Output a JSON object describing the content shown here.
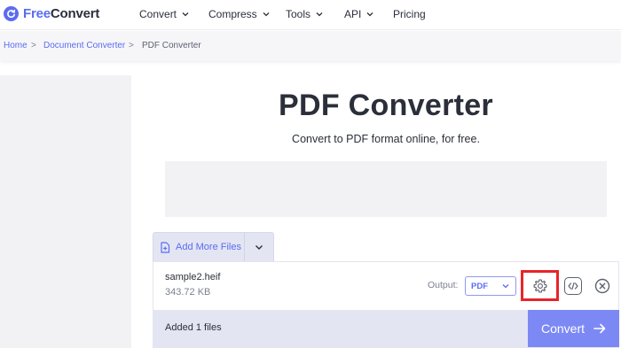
{
  "brand": {
    "name_part1": "Free",
    "name_part2": "Convert",
    "accent": "#5a6cf0",
    "icon": "refresh-logo-icon"
  },
  "nav": {
    "items": [
      {
        "label": "Convert",
        "has_dropdown": true
      },
      {
        "label": "Compress",
        "has_dropdown": true
      },
      {
        "label": "Tools",
        "has_dropdown": true
      },
      {
        "label": "API",
        "has_dropdown": true
      },
      {
        "label": "Pricing",
        "has_dropdown": false
      }
    ]
  },
  "breadcrumb": {
    "items": [
      "Home",
      "Document Converter",
      "PDF Converter"
    ],
    "separator": ">"
  },
  "main": {
    "title": "PDF Converter",
    "subtitle": "Convert to PDF format online, for free."
  },
  "uploader": {
    "add_more_label": "Add More Files",
    "file": {
      "name": "sample2.heif",
      "size": "343.72 KB",
      "output_label": "Output:",
      "output_value": "PDF"
    },
    "status_text": "Added 1 files",
    "convert_label": "Convert",
    "highlight_color": "#e8242b",
    "convert_color": "#7c89f5"
  }
}
